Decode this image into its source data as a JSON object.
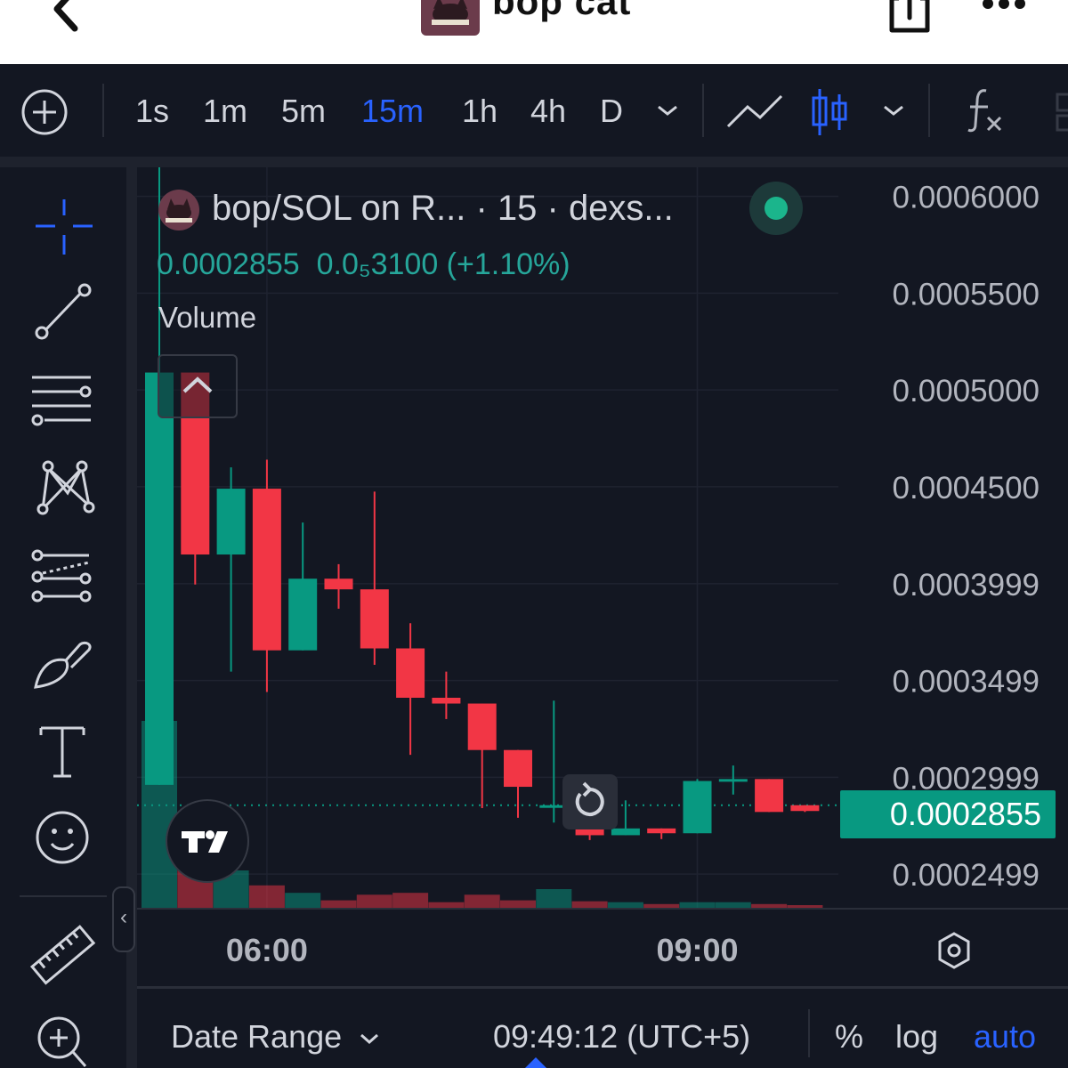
{
  "header": {
    "title": "bop cat"
  },
  "toolbar": {
    "timeframes": [
      {
        "label": "1s",
        "active": false
      },
      {
        "label": "1m",
        "active": false
      },
      {
        "label": "5m",
        "active": false
      },
      {
        "label": "15m",
        "active": true
      },
      {
        "label": "1h",
        "active": false
      },
      {
        "label": "4h",
        "active": false
      },
      {
        "label": "D",
        "active": false
      }
    ],
    "icons": [
      "add-icon",
      "chevron-down-icon",
      "line-chart-icon",
      "candles-icon",
      "chevron-down-icon",
      "indicators-icon"
    ]
  },
  "left_tools": [
    "crosshair-icon",
    "trend-line-icon",
    "horizontal-lines-icon",
    "pattern-icon",
    "forecast-icon",
    "brush-icon",
    "text-icon",
    "emoji-icon",
    "ruler-icon",
    "zoom-icon"
  ],
  "legend": {
    "title": "bop/SOL on R...  · 15 · dexs...",
    "price": "0.0002855",
    "change": "0.0₅3100 (+1.10%)",
    "volume_label": "Volume"
  },
  "price_axis": {
    "labels": [
      "0.0006000",
      "0.0005500",
      "0.0005000",
      "0.0004500",
      "0.0003999",
      "0.0003499",
      "0.0002999",
      "0.0002499"
    ],
    "current": "0.0002855"
  },
  "time_axis": {
    "labels": [
      "06:00",
      "09:00"
    ]
  },
  "bottom_bar": {
    "date_range": "Date Range",
    "clock": "09:49:12 (UTC+5)",
    "percent": "%",
    "log": "log",
    "auto": "auto"
  },
  "colors": {
    "up": "#089981",
    "down": "#f23645",
    "accent": "#2962ff",
    "background": "#131722"
  },
  "chart_data": {
    "type": "candlestick",
    "title": "bop/SOL on R...  · 15 · dexs...",
    "ylim": [
      0.0002325,
      0.000615
    ],
    "y_ticks": [
      0.0006,
      0.00055,
      0.0005,
      0.00045,
      0.0003999,
      0.0003499,
      0.0002999,
      0.0002499
    ],
    "last_price": 0.0002855,
    "x_ticks": [
      "06:00",
      "09:00"
    ],
    "candles": [
      {
        "open": 0.000296,
        "high": 0.00062,
        "low": 0.000296,
        "close": 0.000509,
        "volume": 1.0
      },
      {
        "open": 0.000509,
        "high": 0.000509,
        "low": 0.0003995,
        "close": 0.000415,
        "volume": 0.27
      },
      {
        "open": 0.000415,
        "high": 0.00046,
        "low": 0.0003545,
        "close": 0.000449,
        "volume": 0.2
      },
      {
        "open": 0.000449,
        "high": 0.000464,
        "low": 0.000344,
        "close": 0.0003655,
        "volume": 0.12
      },
      {
        "open": 0.0003655,
        "high": 0.0004315,
        "low": 0.0003655,
        "close": 0.0004025,
        "volume": 0.08
      },
      {
        "open": 0.0004025,
        "high": 0.00041,
        "low": 0.000387,
        "close": 0.000397,
        "volume": 0.04
      },
      {
        "open": 0.000397,
        "high": 0.0004475,
        "low": 0.000358,
        "close": 0.0003665,
        "volume": 0.07
      },
      {
        "open": 0.0003665,
        "high": 0.0003795,
        "low": 0.0003115,
        "close": 0.000341,
        "volume": 0.08
      },
      {
        "open": 0.000341,
        "high": 0.0003545,
        "low": 0.00033,
        "close": 0.000338,
        "volume": 0.03
      },
      {
        "open": 0.000338,
        "high": 0.000338,
        "low": 0.000284,
        "close": 0.000314,
        "volume": 0.07
      },
      {
        "open": 0.000314,
        "high": 0.000314,
        "low": 0.000279,
        "close": 0.000295,
        "volume": 0.04
      },
      {
        "open": 0.0002855,
        "high": 0.0003395,
        "low": 0.0002765,
        "close": 0.0002855,
        "volume": 0.1
      },
      {
        "open": 0.0002855,
        "high": 0.0002855,
        "low": 0.0002675,
        "close": 0.00027,
        "volume": 0.035
      },
      {
        "open": 0.00027,
        "high": 0.000288,
        "low": 0.00027,
        "close": 0.0002735,
        "volume": 0.03
      },
      {
        "open": 0.0002735,
        "high": 0.0002735,
        "low": 0.000268,
        "close": 0.000271,
        "volume": 0.02
      },
      {
        "open": 0.000271,
        "high": 0.000299,
        "low": 0.000271,
        "close": 0.000298,
        "volume": 0.03
      },
      {
        "open": 0.000298,
        "high": 0.000306,
        "low": 0.000291,
        "close": 0.000299,
        "volume": 0.03
      },
      {
        "open": 0.000299,
        "high": 0.000299,
        "low": 0.000282,
        "close": 0.000282,
        "volume": 0.02
      },
      {
        "open": 0.0002855,
        "high": 0.0002855,
        "low": 0.000282,
        "close": 0.0002825,
        "volume": 0.01
      }
    ]
  }
}
